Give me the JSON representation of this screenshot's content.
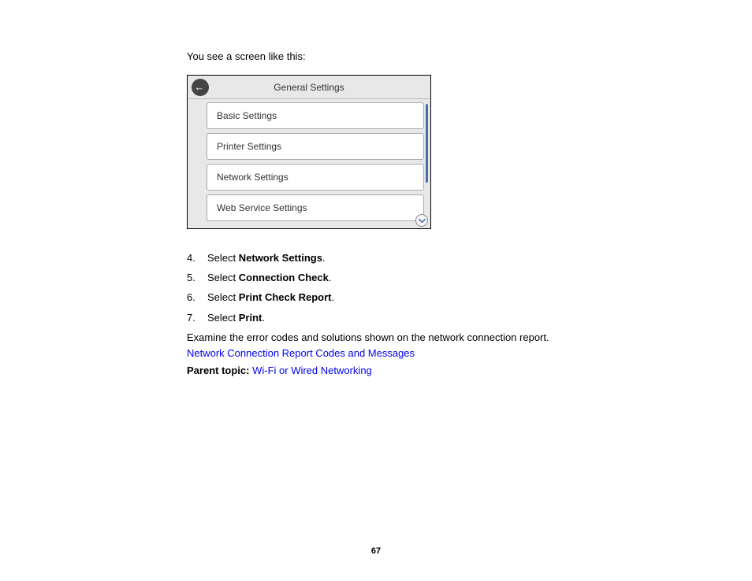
{
  "intro": "You see a screen like this:",
  "panel": {
    "title": "General Settings",
    "items": [
      "Basic Settings",
      "Printer Settings",
      "Network Settings",
      "Web Service Settings"
    ]
  },
  "steps": [
    {
      "prefix": "Select ",
      "bold": "Network Settings",
      "suffix": "."
    },
    {
      "prefix": "Select ",
      "bold": "Connection Check",
      "suffix": "."
    },
    {
      "prefix": "Select ",
      "bold": "Print Check Report",
      "suffix": "."
    },
    {
      "prefix": "Select ",
      "bold": "Print",
      "suffix": "."
    }
  ],
  "examine_text": "Examine the error codes and solutions shown on the network connection report.",
  "link1": "Network Connection Report Codes and Messages",
  "parent_topic_label": "Parent topic:",
  "parent_topic_link": "Wi-Fi or Wired Networking",
  "page_number": "67"
}
